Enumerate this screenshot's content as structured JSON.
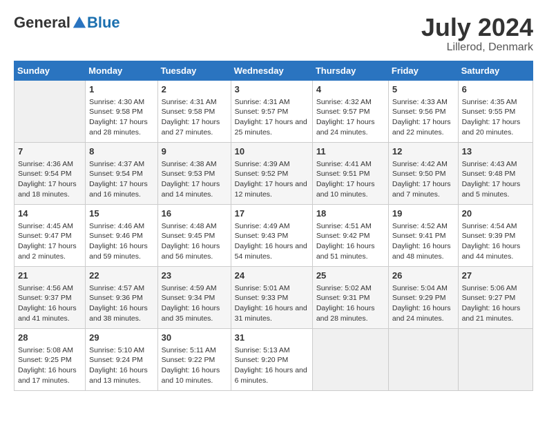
{
  "header": {
    "logo_general": "General",
    "logo_blue": "Blue",
    "month_year": "July 2024",
    "location": "Lillerod, Denmark"
  },
  "weekdays": [
    "Sunday",
    "Monday",
    "Tuesday",
    "Wednesday",
    "Thursday",
    "Friday",
    "Saturday"
  ],
  "weeks": [
    [
      {
        "day": "",
        "info": ""
      },
      {
        "day": "1",
        "info": "Sunrise: 4:30 AM\nSunset: 9:58 PM\nDaylight: 17 hours and 28 minutes."
      },
      {
        "day": "2",
        "info": "Sunrise: 4:31 AM\nSunset: 9:58 PM\nDaylight: 17 hours and 27 minutes."
      },
      {
        "day": "3",
        "info": "Sunrise: 4:31 AM\nSunset: 9:57 PM\nDaylight: 17 hours and 25 minutes."
      },
      {
        "day": "4",
        "info": "Sunrise: 4:32 AM\nSunset: 9:57 PM\nDaylight: 17 hours and 24 minutes."
      },
      {
        "day": "5",
        "info": "Sunrise: 4:33 AM\nSunset: 9:56 PM\nDaylight: 17 hours and 22 minutes."
      },
      {
        "day": "6",
        "info": "Sunrise: 4:35 AM\nSunset: 9:55 PM\nDaylight: 17 hours and 20 minutes."
      }
    ],
    [
      {
        "day": "7",
        "info": "Sunrise: 4:36 AM\nSunset: 9:54 PM\nDaylight: 17 hours and 18 minutes."
      },
      {
        "day": "8",
        "info": "Sunrise: 4:37 AM\nSunset: 9:54 PM\nDaylight: 17 hours and 16 minutes."
      },
      {
        "day": "9",
        "info": "Sunrise: 4:38 AM\nSunset: 9:53 PM\nDaylight: 17 hours and 14 minutes."
      },
      {
        "day": "10",
        "info": "Sunrise: 4:39 AM\nSunset: 9:52 PM\nDaylight: 17 hours and 12 minutes."
      },
      {
        "day": "11",
        "info": "Sunrise: 4:41 AM\nSunset: 9:51 PM\nDaylight: 17 hours and 10 minutes."
      },
      {
        "day": "12",
        "info": "Sunrise: 4:42 AM\nSunset: 9:50 PM\nDaylight: 17 hours and 7 minutes."
      },
      {
        "day": "13",
        "info": "Sunrise: 4:43 AM\nSunset: 9:48 PM\nDaylight: 17 hours and 5 minutes."
      }
    ],
    [
      {
        "day": "14",
        "info": "Sunrise: 4:45 AM\nSunset: 9:47 PM\nDaylight: 17 hours and 2 minutes."
      },
      {
        "day": "15",
        "info": "Sunrise: 4:46 AM\nSunset: 9:46 PM\nDaylight: 16 hours and 59 minutes."
      },
      {
        "day": "16",
        "info": "Sunrise: 4:48 AM\nSunset: 9:45 PM\nDaylight: 16 hours and 56 minutes."
      },
      {
        "day": "17",
        "info": "Sunrise: 4:49 AM\nSunset: 9:43 PM\nDaylight: 16 hours and 54 minutes."
      },
      {
        "day": "18",
        "info": "Sunrise: 4:51 AM\nSunset: 9:42 PM\nDaylight: 16 hours and 51 minutes."
      },
      {
        "day": "19",
        "info": "Sunrise: 4:52 AM\nSunset: 9:41 PM\nDaylight: 16 hours and 48 minutes."
      },
      {
        "day": "20",
        "info": "Sunrise: 4:54 AM\nSunset: 9:39 PM\nDaylight: 16 hours and 44 minutes."
      }
    ],
    [
      {
        "day": "21",
        "info": "Sunrise: 4:56 AM\nSunset: 9:37 PM\nDaylight: 16 hours and 41 minutes."
      },
      {
        "day": "22",
        "info": "Sunrise: 4:57 AM\nSunset: 9:36 PM\nDaylight: 16 hours and 38 minutes."
      },
      {
        "day": "23",
        "info": "Sunrise: 4:59 AM\nSunset: 9:34 PM\nDaylight: 16 hours and 35 minutes."
      },
      {
        "day": "24",
        "info": "Sunrise: 5:01 AM\nSunset: 9:33 PM\nDaylight: 16 hours and 31 minutes."
      },
      {
        "day": "25",
        "info": "Sunrise: 5:02 AM\nSunset: 9:31 PM\nDaylight: 16 hours and 28 minutes."
      },
      {
        "day": "26",
        "info": "Sunrise: 5:04 AM\nSunset: 9:29 PM\nDaylight: 16 hours and 24 minutes."
      },
      {
        "day": "27",
        "info": "Sunrise: 5:06 AM\nSunset: 9:27 PM\nDaylight: 16 hours and 21 minutes."
      }
    ],
    [
      {
        "day": "28",
        "info": "Sunrise: 5:08 AM\nSunset: 9:25 PM\nDaylight: 16 hours and 17 minutes."
      },
      {
        "day": "29",
        "info": "Sunrise: 5:10 AM\nSunset: 9:24 PM\nDaylight: 16 hours and 13 minutes."
      },
      {
        "day": "30",
        "info": "Sunrise: 5:11 AM\nSunset: 9:22 PM\nDaylight: 16 hours and 10 minutes."
      },
      {
        "day": "31",
        "info": "Sunrise: 5:13 AM\nSunset: 9:20 PM\nDaylight: 16 hours and 6 minutes."
      },
      {
        "day": "",
        "info": ""
      },
      {
        "day": "",
        "info": ""
      },
      {
        "day": "",
        "info": ""
      }
    ]
  ]
}
